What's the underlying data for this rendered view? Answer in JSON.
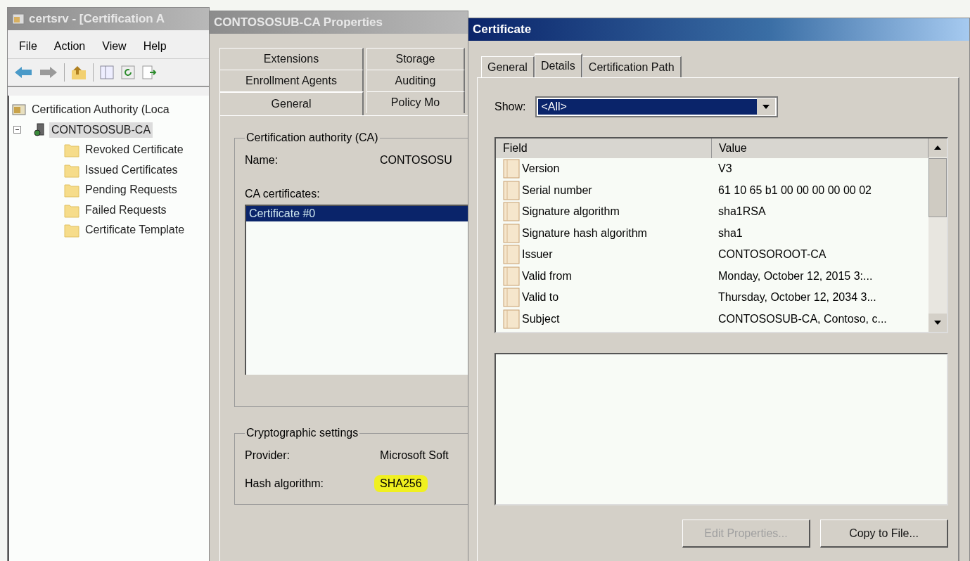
{
  "mmc_window": {
    "title": "certsrv - [Certification A",
    "menu": [
      "File",
      "Action",
      "View",
      "Help"
    ],
    "tree": [
      {
        "label": "Certification Authority (Loca",
        "kind": "root",
        "selected": false,
        "children": [
          {
            "label": "CONTOSOSUB-CA",
            "kind": "server",
            "selected": true,
            "expanded": true,
            "children": [
              {
                "label": "Revoked Certificate",
                "kind": "folder",
                "selected": false
              },
              {
                "label": "Issued Certificates",
                "kind": "folder",
                "selected": false
              },
              {
                "label": "Pending Requests",
                "kind": "folder",
                "selected": false
              },
              {
                "label": "Failed Requests",
                "kind": "folder",
                "selected": false
              },
              {
                "label": "Certificate Template",
                "kind": "folder",
                "selected": false
              }
            ]
          }
        ]
      }
    ]
  },
  "properties_window": {
    "title": "CONTOSOSUB-CA Properties",
    "tab_rows": [
      [
        {
          "label": "Extensions",
          "selected": false
        },
        {
          "label": "Storage",
          "selected": false
        }
      ],
      [
        {
          "label": "Enrollment Agents",
          "selected": false
        },
        {
          "label": "Auditing",
          "selected": false
        }
      ],
      [
        {
          "label": "General",
          "selected": true
        },
        {
          "label": "Policy Mo",
          "selected": false
        }
      ]
    ],
    "ca_group": {
      "title": "Certification authority (CA)",
      "name_label": "Name:",
      "name_value": "CONTOSOSU",
      "certificates_label": "CA certificates:",
      "certificates": [
        {
          "label": "Certificate #0",
          "selected": true
        }
      ]
    },
    "crypto_group": {
      "title": "Cryptographic settings",
      "provider_label": "Provider:",
      "provider_value": "Microsoft Soft",
      "hash_label": "Hash algorithm:",
      "hash_value": "SHA256",
      "hash_highlighted": true
    }
  },
  "certificate_window": {
    "title": "Certificate",
    "tabs": [
      {
        "label": "General",
        "selected": false
      },
      {
        "label": "Details",
        "selected": true
      },
      {
        "label": "Certification Path",
        "selected": false
      }
    ],
    "show_label": "Show:",
    "show_value": "<All>",
    "columns": [
      "Field",
      "Value"
    ],
    "rows": [
      {
        "field": "Version",
        "value": "V3"
      },
      {
        "field": "Serial number",
        "value": "61 10 65 b1 00 00 00 00 00 02"
      },
      {
        "field": "Signature algorithm",
        "value": "sha1RSA"
      },
      {
        "field": "Signature hash algorithm",
        "value": "sha1"
      },
      {
        "field": "Issuer",
        "value": "CONTOSOROOT-CA"
      },
      {
        "field": "Valid from",
        "value": "Monday, October 12, 2015 3:..."
      },
      {
        "field": "Valid to",
        "value": "Thursday, October 12, 2034 3..."
      },
      {
        "field": "Subject",
        "value": "CONTOSOSUB-CA, Contoso, c..."
      }
    ],
    "buttons": [
      {
        "label": "Edit Properties...",
        "disabled": true
      },
      {
        "label": "Copy to File...",
        "disabled": false
      }
    ]
  }
}
